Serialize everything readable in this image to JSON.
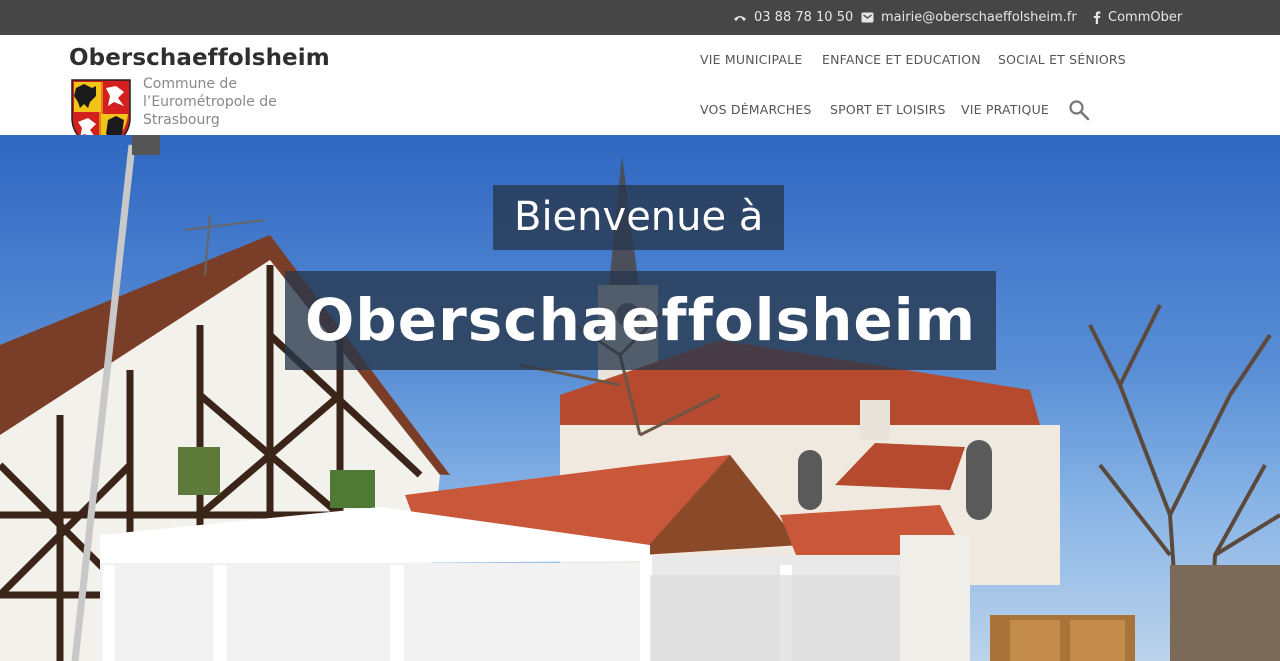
{
  "topbar": {
    "phone": "03 88 78 10 50",
    "email": "mairie@oberschaeffolsheim.fr",
    "facebook": "CommOber",
    "phone_icon": "phone-icon",
    "email_icon": "envelope-icon",
    "facebook_icon": "facebook-icon"
  },
  "header": {
    "site_title": "Oberschaeffolsheim",
    "tagline": "Commune de l’Eurométropole de Strasbourg",
    "logo_icon": "coat-of-arms-icon"
  },
  "nav": {
    "items": [
      "VIE MUNICIPALE",
      "ENFANCE ET EDUCATION",
      "SOCIAL ET SÉNIORS",
      "VOS DÉMARCHES",
      "SPORT ET LOISIRS",
      "VIE PRATIQUE"
    ],
    "search_icon": "search-icon"
  },
  "hero": {
    "line1": "Bienvenue à",
    "line2": "Oberschaeffolsheim"
  },
  "colors": {
    "topbar_bg": "#464646",
    "hero_banner_bg": "#28374b"
  }
}
